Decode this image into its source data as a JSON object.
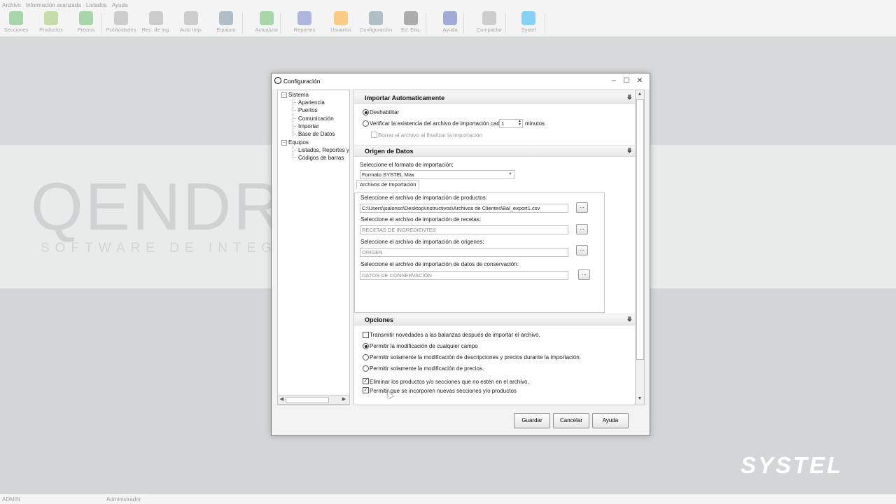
{
  "menu": [
    "Archivo",
    "Información avanzada",
    "Listados",
    "Ayuda"
  ],
  "toolbar": [
    {
      "label": "Secciones",
      "icon": "sections-icon",
      "color": "#4caf50"
    },
    {
      "label": "Productos",
      "icon": "products-icon",
      "color": "#8bc34a"
    },
    {
      "label": "Precios",
      "icon": "prices-icon",
      "color": "#4caf50"
    },
    {
      "label": "Publicidades",
      "icon": "ads-icon",
      "color": "#9e9e9e"
    },
    {
      "label": "Rec. de Ing.",
      "icon": "recipe-icon",
      "color": "#9e9e9e"
    },
    {
      "label": "Auto Imp.",
      "icon": "auto-import-icon",
      "color": "#9e9e9e"
    },
    {
      "label": "Equipos",
      "icon": "devices-icon",
      "color": "#607d8b"
    },
    {
      "label": "Actualizar",
      "icon": "update-icon",
      "color": "#4caf50"
    },
    {
      "label": "Reportes",
      "icon": "reports-icon",
      "color": "#5c6bc0"
    },
    {
      "label": "Usuarios",
      "icon": "users-icon",
      "color": "#ff9800"
    },
    {
      "label": "Configuración",
      "icon": "settings-icon",
      "color": "#607d8b"
    },
    {
      "label": "Ed. Etiq.",
      "icon": "barcode-icon",
      "color": "#555555"
    },
    {
      "label": "Ayuda",
      "icon": "help-icon",
      "color": "#3f51b5"
    },
    {
      "label": "Compactar",
      "icon": "compact-icon",
      "color": "#9e9e9e"
    },
    {
      "label": "Systel",
      "icon": "systel-icon",
      "color": "#03a9f4"
    }
  ],
  "background": {
    "logo_main": "QENDR",
    "logo_sub": "SOFTWARE DE INTEG",
    "brand": "SYSTEL"
  },
  "status": {
    "user": "ADMIN",
    "role": "Administrador"
  },
  "dialog": {
    "title": "Configuración",
    "tree": {
      "root1": "Sistema",
      "root1_children": [
        "Apariencia",
        "Puertos",
        "Comunicación",
        "Importar",
        "Base de Datos"
      ],
      "root2": "Equipos",
      "root2_children": [
        "Listados, Reportes y C",
        "Códigos de barras"
      ]
    },
    "import_auto": {
      "title": "Importar Automaticamente",
      "opt_disable": "Deshabilitar",
      "opt_check": "Verificar la existencia del archivo de importación cada",
      "minutes_value": "1",
      "minutes_label": "minutos",
      "delete_after": "Borrar el archivo al finalizar la importación"
    },
    "origin": {
      "title": "Origen  de Datos",
      "format_label": "Seleccione el formato de importación:",
      "format_value": "Formato SYSTEL Max",
      "tab": "Archivos de Importación",
      "products_label": "Seleccione el archivo de importación de productos:",
      "products_value": "C:\\Users\\jsalonso\\Desktop\\Instructivos\\Archivos de Clientes\\Bal_export1.csv",
      "recipes_label": "Seleccione el archivo de importación de recetas:",
      "recipes_value": "RECETAS DE INGREDIENTES",
      "origins_label": "Seleccione el archivo de importación de origenes:",
      "origins_value": "ORIGEN",
      "conservation_label": "Seleccione el archivo de importación de datos de conservación:",
      "conservation_value": "DATOS DE CONSERVACIÓN",
      "browse": "..."
    },
    "options": {
      "title": "Opciones",
      "transmit": "Transmitir novedades a las balanzas después de importar el archivo.",
      "allow_any": "Permitir la modificación de cualquier campo",
      "allow_desc": "Permitir solamente la modificación de descripciones y precios durante la importación.",
      "allow_prices": "Permitir solamente la modificación de precios.",
      "delete_missing": "Eliminar los productos y/o secciones que no estén en el archivo.",
      "allow_new": "Permitir que se incorporen nuevas secciones y/o productos"
    },
    "buttons": {
      "save": "Guardar",
      "cancel": "Cancelar",
      "help": "Ayuda"
    }
  }
}
